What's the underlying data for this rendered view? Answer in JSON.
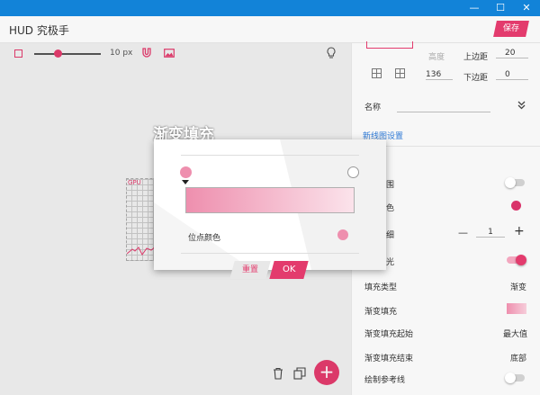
{
  "window": {
    "minimize": "—",
    "maximize": "☐",
    "close": "✕"
  },
  "app": {
    "title": "HUD 究极手",
    "save_label": "保存"
  },
  "toolbar": {
    "slider_value": "10 px",
    "slider_fraction": 0.3
  },
  "hud": {
    "label": "GPU"
  },
  "panel": {
    "width_label": "高度",
    "top_margin_label": "上边距",
    "top_margin_value": "20",
    "height_value": "136",
    "bottom_margin_label": "下边距",
    "bottom_margin_value": "0",
    "name_label": "名称",
    "name_value": "",
    "new_chart_settings": "新线图设置",
    "rows": [
      {
        "label": "填充类型",
        "value": "渐变"
      },
      {
        "label": "渐变填充",
        "value": ""
      },
      {
        "label": "渐变填充起始",
        "value": "最大值"
      },
      {
        "label": "渐变填充结束",
        "value": "底部"
      },
      {
        "label": "绘制参考线",
        "value": ""
      }
    ],
    "partial_labels": {
      "range": "围",
      "color": "色",
      "thickness": "细",
      "glow": "光"
    },
    "thickness_value": "1",
    "minus": "—",
    "plus": "+"
  },
  "dialog": {
    "title": "渐变填充",
    "point_color_label": "位点颜色",
    "reset_label": "重置",
    "ok_label": "OK"
  },
  "colors": {
    "accent": "#e33b6d",
    "titlebar": "#1283d8",
    "gradient_start": "#ee8fae",
    "gradient_end": "#fbe3eb"
  },
  "icons": {
    "square": "square-icon",
    "magnet": "magnet-icon",
    "image": "image-icon",
    "bulb": "lightbulb-icon",
    "trash": "trash-icon",
    "copy": "copy-icon",
    "add": "plus-icon",
    "collapse": "double-chevron-down-icon",
    "grid": "grid-icon"
  }
}
